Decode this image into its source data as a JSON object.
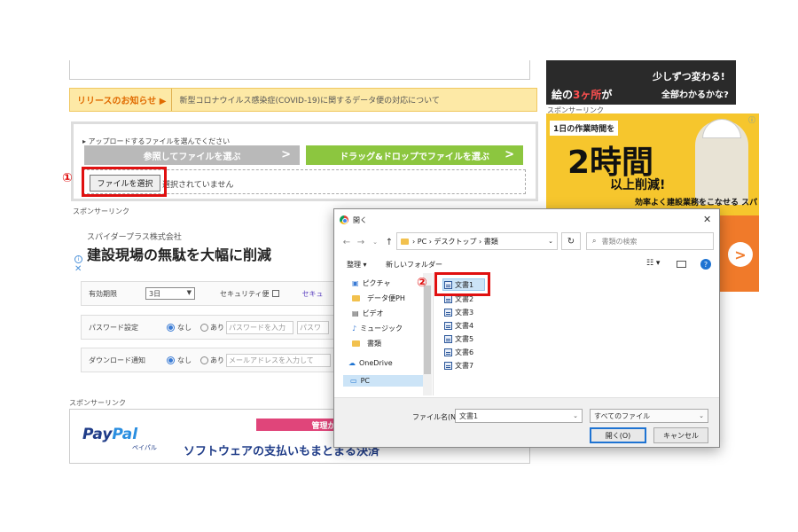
{
  "release": {
    "tag": "リリースのお知らせ ▶",
    "message": "新型コロナウイルス感染症(COVID-19)に関するデータ便の対応について"
  },
  "upload": {
    "hint": "▸ アップロードするファイルを選んでください",
    "browse_label": "参照してファイルを選ぶ",
    "drag_label": "ドラッグ&ドロップでファイルを選ぶ",
    "choose_button": "ファイルを選択",
    "no_file": "選択されていません"
  },
  "annotations": {
    "step1": "①",
    "step2": "②"
  },
  "sponsor_label": "スポンサーリンク",
  "ad_card": {
    "company": "スパイダープラス株式会社",
    "headline": "建設現場の無駄を大幅に削減",
    "info_icon": "info-icon",
    "close_icon": "close-icon"
  },
  "settings": {
    "expiry_label": "有効期限",
    "expiry_value": "3日",
    "security_label": "セキュリティ便",
    "security_link": "セキュ",
    "password_label": "パスワード設定",
    "password_opt_none": "なし",
    "password_opt_yes": "あり",
    "password_placeholder": "パスワードを入力",
    "password_placeholder2": "パスワ",
    "download_label": "ダウンロード通知",
    "download_opt_none": "なし",
    "download_opt_yes": "あり",
    "download_placeholder": "メールアドレスを入力して"
  },
  "paypal_ad": {
    "logo_pay": "Pay",
    "logo_pal": "Pal",
    "kana": "ペイパル",
    "pink": "管理がラク",
    "text": "ソフトウェアの支払いもまとまる決済"
  },
  "right_ads": {
    "ad1_line1_a": "絵の",
    "ad1_line1_b": "3ヶ所",
    "ad1_line1_c": "が",
    "ad1_line2": "少しずつ変わる!",
    "ad1_line3": "全部わかるかな?",
    "sponsor": "スポンサーリンク",
    "ad2_line1": "1日の作業時間を",
    "ad2_line2": "2時間",
    "ad2_line3": "以上削減!",
    "ad2_line4": "効率よく建設業務をこなせる スパイダープラス"
  },
  "dialog": {
    "title": "開く",
    "path": [
      "PC",
      "デスクトップ",
      "書類"
    ],
    "search_placeholder": "書類の検索",
    "organize": "整理 ▾",
    "new_folder": "新しいフォルダー",
    "nav_items": [
      "ピクチャ",
      "データ便PH",
      "ビデオ",
      "ミュージック",
      "書類",
      "OneDrive",
      "PC"
    ],
    "files": [
      "文書1",
      "文書2",
      "文書3",
      "文書4",
      "文書5",
      "文書6",
      "文書7"
    ],
    "filename_label": "ファイル名(N):",
    "filename_value": "文書1",
    "filetype_value": "すべてのファイル",
    "open_button": "開く(O)",
    "cancel_button": "キャンセル"
  }
}
